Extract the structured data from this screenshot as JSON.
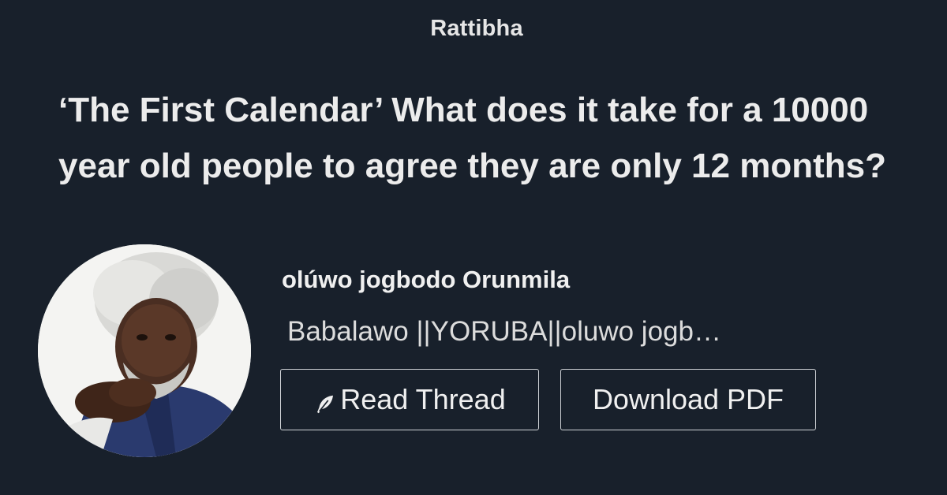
{
  "brand": "Rattibha",
  "thread": {
    "title": "‘The First Calendar’ What does it take for a 10000 year old people to agree they are only 12 months?"
  },
  "author": {
    "name": "olúwo jogbodo Orunmila",
    "bio": "Babalawo ||YORUBA||oluwo jogbodo Orunmila"
  },
  "actions": {
    "read_icon": "feather-icon",
    "read_label": "Read Thread",
    "pdf_label": "Download PDF"
  },
  "colors": {
    "background": "#18202b",
    "text": "#ececec",
    "button_border": "#cfd2d6"
  }
}
